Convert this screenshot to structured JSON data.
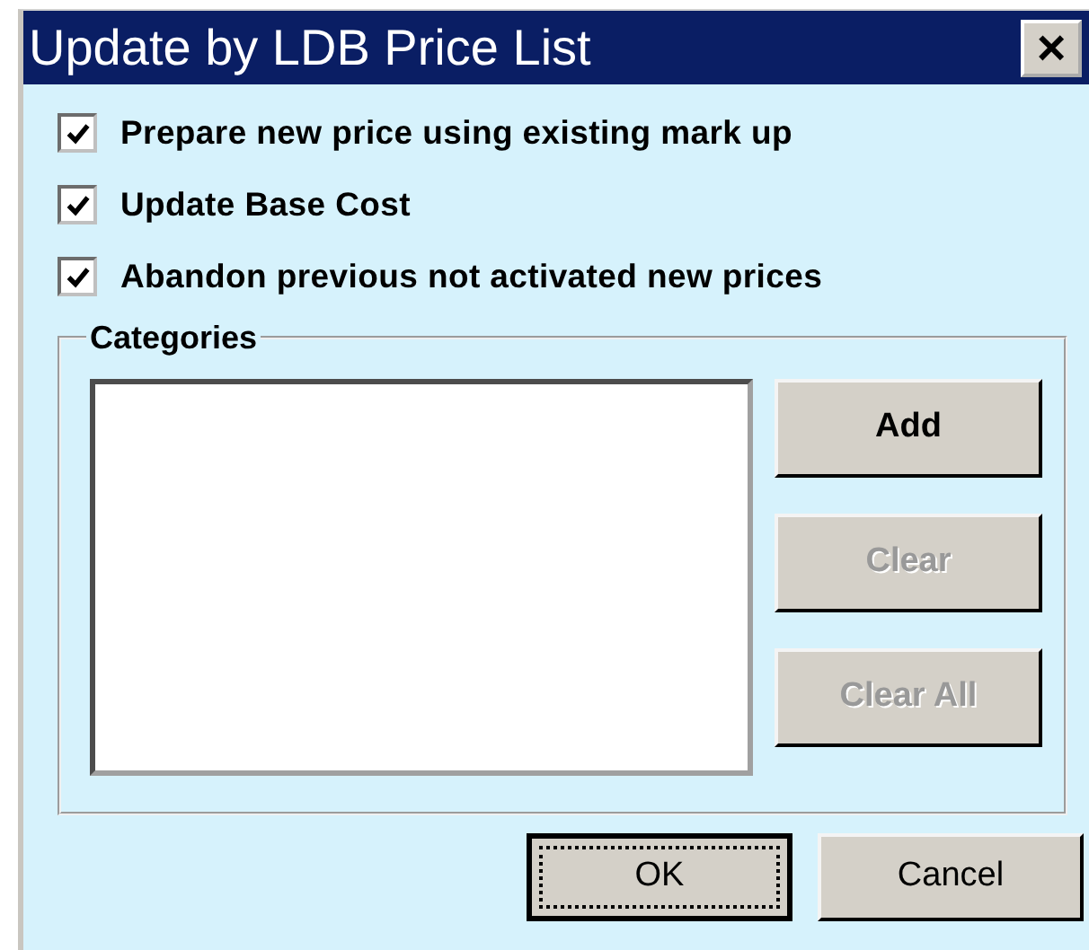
{
  "window": {
    "title": "Update by LDB Price List",
    "close": "×"
  },
  "options": [
    {
      "label": "Prepare new price using existing mark up",
      "checked": true
    },
    {
      "label": "Update Base Cost",
      "checked": true
    },
    {
      "label": "Abandon previous not activated new prices",
      "checked": true
    }
  ],
  "categories": {
    "title": "Categories",
    "buttons": [
      {
        "label": "Add",
        "disabled": false
      },
      {
        "label": "Clear",
        "disabled": true
      },
      {
        "label": "Clear All",
        "disabled": true
      }
    ]
  },
  "buttons": [
    {
      "label": "OK",
      "default": true
    },
    {
      "label": "Cancel",
      "default": false
    }
  ]
}
